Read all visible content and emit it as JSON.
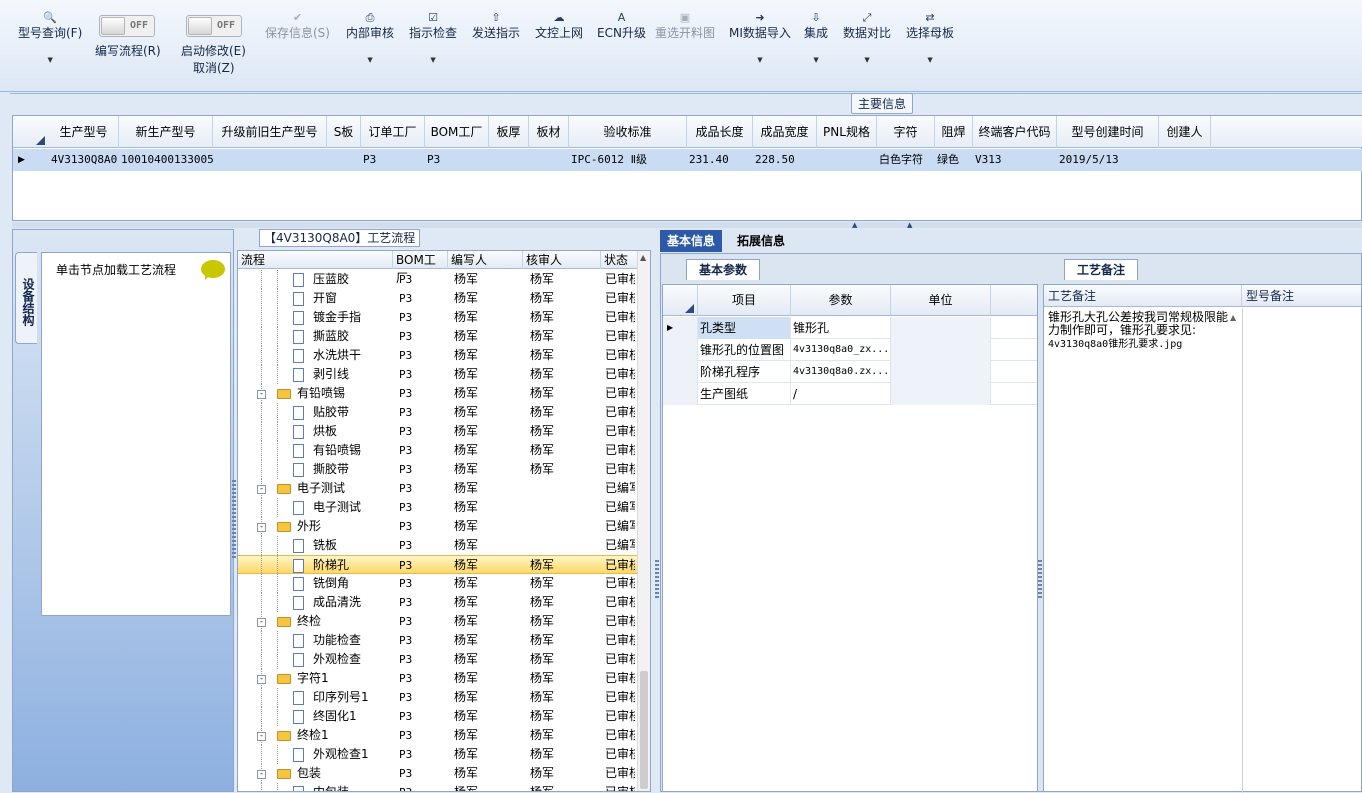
{
  "toolbar": {
    "query": {
      "label": "型号查询(F)",
      "icon": "search-icon"
    },
    "write_flow": {
      "label": "编写流程(R)",
      "toggle": "OFF"
    },
    "enable_edit": {
      "label": "启动修改(E)",
      "sub": "取消(Z)",
      "toggle": "OFF"
    },
    "save": {
      "label": "保存信息(S)",
      "icon": "check-icon"
    },
    "internal_review": {
      "label": "内部审核",
      "icon": "printer-icon"
    },
    "instruction_check": {
      "label": "指示检查",
      "icon": "checkbox-icon"
    },
    "send_instruction": {
      "label": "发送指示",
      "icon": "upload-icon"
    },
    "doc_control": {
      "label": "文控上网",
      "icon": "cloud-upload-icon"
    },
    "ecn": {
      "label": "ECN升级",
      "icon": "ecn-icon"
    },
    "reselect": {
      "label": "重选开料图",
      "icon": "image-icon"
    },
    "mi_import": {
      "label": "MI数据导入",
      "icon": "sign-in-icon"
    },
    "integrate": {
      "label": "集成",
      "icon": "download-icon"
    },
    "compare": {
      "label": "数据对比",
      "icon": "compress-icon"
    },
    "select_master": {
      "label": "选择母板",
      "icon": "shuffle-icon"
    }
  },
  "main_info": {
    "title": "主要信息",
    "columns": [
      "生产型号",
      "新生产型号",
      "升级前旧生产型号",
      "S板",
      "订单工厂",
      "BOM工厂",
      "板厚",
      "板材",
      "验收标准",
      "成品长度",
      "成品宽度",
      "PNL规格",
      "字符",
      "阻焊",
      "终端客户代码",
      "型号创建时间",
      "创建人"
    ],
    "row": [
      "4V3130Q8A0",
      "10010400133005",
      "",
      "",
      "P3",
      "P3",
      "",
      "",
      "IPC-6012 Ⅱ级",
      "231.40",
      "228.50",
      "",
      "白色字符",
      "绿色",
      "V313",
      "2019/5/13",
      ""
    ]
  },
  "left_panel": {
    "vtab": "设备结构",
    "hint": "单击节点加载工艺流程"
  },
  "flow": {
    "title": "【4V3130Q8A0】工艺流程",
    "columns": [
      "流程",
      "BOM工厂",
      "编写人",
      "核审人",
      "状态"
    ],
    "rows": [
      {
        "name": "压蓝胶",
        "type": "doc",
        "level": 2,
        "bom": "P3",
        "writer": "杨军",
        "reviewer": "杨军",
        "status": "已审核"
      },
      {
        "name": "开窗",
        "type": "doc",
        "level": 2,
        "bom": "P3",
        "writer": "杨军",
        "reviewer": "杨军",
        "status": "已审核"
      },
      {
        "name": "镀金手指",
        "type": "doc",
        "level": 2,
        "bom": "P3",
        "writer": "杨军",
        "reviewer": "杨军",
        "status": "已审核"
      },
      {
        "name": "撕蓝胶",
        "type": "doc",
        "level": 2,
        "bom": "P3",
        "writer": "杨军",
        "reviewer": "杨军",
        "status": "已审核"
      },
      {
        "name": "水洗烘干",
        "type": "doc",
        "level": 2,
        "bom": "P3",
        "writer": "杨军",
        "reviewer": "杨军",
        "status": "已审核"
      },
      {
        "name": "剥引线",
        "type": "doc",
        "level": 2,
        "bom": "P3",
        "writer": "杨军",
        "reviewer": "杨军",
        "status": "已审核"
      },
      {
        "name": "有铅喷锡",
        "type": "folder",
        "level": 1,
        "bom": "P3",
        "writer": "杨军",
        "reviewer": "杨军",
        "status": "已审核"
      },
      {
        "name": "贴胶带",
        "type": "doc",
        "level": 2,
        "bom": "P3",
        "writer": "杨军",
        "reviewer": "杨军",
        "status": "已审核"
      },
      {
        "name": "烘板",
        "type": "doc",
        "level": 2,
        "bom": "P3",
        "writer": "杨军",
        "reviewer": "杨军",
        "status": "已审核"
      },
      {
        "name": "有铅喷锡",
        "type": "doc",
        "level": 2,
        "bom": "P3",
        "writer": "杨军",
        "reviewer": "杨军",
        "status": "已审核"
      },
      {
        "name": "撕胶带",
        "type": "doc",
        "level": 2,
        "bom": "P3",
        "writer": "杨军",
        "reviewer": "杨军",
        "status": "已审核"
      },
      {
        "name": "电子测试",
        "type": "folder",
        "level": 1,
        "bom": "P3",
        "writer": "杨军",
        "reviewer": "",
        "status": "已编写"
      },
      {
        "name": "电子测试",
        "type": "doc",
        "level": 2,
        "bom": "P3",
        "writer": "杨军",
        "reviewer": "",
        "status": "已编写"
      },
      {
        "name": "外形",
        "type": "folder",
        "level": 1,
        "bom": "P3",
        "writer": "杨军",
        "reviewer": "",
        "status": "已编写"
      },
      {
        "name": "铣板",
        "type": "doc",
        "level": 2,
        "bom": "P3",
        "writer": "杨军",
        "reviewer": "",
        "status": "已编写"
      },
      {
        "name": "阶梯孔",
        "type": "doc",
        "level": 2,
        "bom": "P3",
        "writer": "杨军",
        "reviewer": "杨军",
        "status": "已审核",
        "selected": true
      },
      {
        "name": "铣倒角",
        "type": "doc",
        "level": 2,
        "bom": "P3",
        "writer": "杨军",
        "reviewer": "杨军",
        "status": "已审核"
      },
      {
        "name": "成品清洗",
        "type": "doc",
        "level": 2,
        "bom": "P3",
        "writer": "杨军",
        "reviewer": "杨军",
        "status": "已审核"
      },
      {
        "name": "终检",
        "type": "folder",
        "level": 1,
        "bom": "P3",
        "writer": "杨军",
        "reviewer": "杨军",
        "status": "已审核"
      },
      {
        "name": "功能检查",
        "type": "doc",
        "level": 2,
        "bom": "P3",
        "writer": "杨军",
        "reviewer": "杨军",
        "status": "已审核"
      },
      {
        "name": "外观检查",
        "type": "doc",
        "level": 2,
        "bom": "P3",
        "writer": "杨军",
        "reviewer": "杨军",
        "status": "已审核"
      },
      {
        "name": "字符1",
        "type": "folder",
        "level": 1,
        "bom": "P3",
        "writer": "杨军",
        "reviewer": "杨军",
        "status": "已审核"
      },
      {
        "name": "印序列号1",
        "type": "doc",
        "level": 2,
        "bom": "P3",
        "writer": "杨军",
        "reviewer": "杨军",
        "status": "已审核"
      },
      {
        "name": "终固化1",
        "type": "doc",
        "level": 2,
        "bom": "P3",
        "writer": "杨军",
        "reviewer": "杨军",
        "status": "已审核"
      },
      {
        "name": "终检1",
        "type": "folder",
        "level": 1,
        "bom": "P3",
        "writer": "杨军",
        "reviewer": "杨军",
        "status": "已审核"
      },
      {
        "name": "外观检查1",
        "type": "doc",
        "level": 2,
        "bom": "P3",
        "writer": "杨军",
        "reviewer": "杨军",
        "status": "已审核"
      },
      {
        "name": "包装",
        "type": "folder",
        "level": 1,
        "bom": "P3",
        "writer": "杨军",
        "reviewer": "杨军",
        "status": "已审核"
      },
      {
        "name": "内包装",
        "type": "doc",
        "level": 2,
        "bom": "P3",
        "writer": "杨军",
        "reviewer": "杨军",
        "status": "已审核"
      }
    ]
  },
  "right": {
    "tabs": [
      "基本信息",
      "拓展信息"
    ],
    "params_tab": "基本参数",
    "param_columns": [
      "项目",
      "参数",
      "单位"
    ],
    "params": [
      {
        "item": "孔类型",
        "value": "锥形孔",
        "unit": ""
      },
      {
        "item": "锥形孔的位置图",
        "value": "4v3130q8a0_zx...",
        "unit": ""
      },
      {
        "item": "阶梯孔程序",
        "value": "4v3130q8a0.zx...",
        "unit": ""
      },
      {
        "item": "生产图纸",
        "value": "/",
        "unit": ""
      }
    ],
    "note_tab": "工艺备注",
    "note_columns": [
      "工艺备注",
      "型号备注"
    ],
    "note_text": "锥形孔大孔公差按我司常规极限能力制作即可，锥形孔要求见:",
    "note_file": "4v3130q8a0锥形孔要求.jpg"
  }
}
